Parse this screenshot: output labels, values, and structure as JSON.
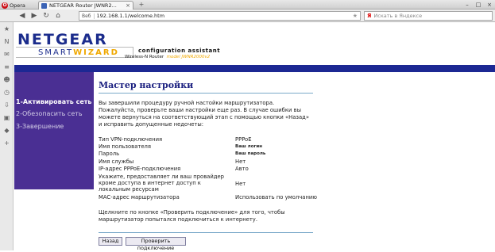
{
  "browser": {
    "app_tab": "Opera",
    "active_tab_title": "NETGEAR Router JWNR2...",
    "new_tab": "+",
    "address_badge": "Веб",
    "url": "192.168.1.1/welcome.htm",
    "search_placeholder": "Искать в Яндексе",
    "search_engine_glyph": "Я"
  },
  "header": {
    "brand": "NETGEAR",
    "smart": "SMART",
    "wizard": "WIZARD",
    "config_title": "configuration assistant",
    "product": "Wireless-N Router",
    "model": "model JWNR2000v2",
    "brand_color": "#1b2c8c",
    "accent_color": "#f0a800",
    "bar_color": "#1c2893"
  },
  "sidebar": {
    "steps": [
      {
        "label": "1-Активировать сеть"
      },
      {
        "label": "2-Обезопасить сеть"
      },
      {
        "label": "3-Завершение"
      }
    ],
    "bg_color": "#4a2f93"
  },
  "content": {
    "title": "Мастер настройки",
    "intro": "Вы завершили процедуру ручной настойки маршрутизатора. Пожалуйста, проверьте ваши настройки еще раз. В случае ошибки вы можете вернуться на соответствующий этап с помощью кнопки «Назад» и исправить допущенные недочеты:",
    "rows": [
      {
        "key": "Тип VPN-подключения",
        "value": "PPPoE"
      },
      {
        "key": "Имя пользователя",
        "value": "Ваш логин"
      },
      {
        "key": "Пароль",
        "value": "Ваш пароль"
      },
      {
        "key": "Имя службы",
        "value": "Нет"
      },
      {
        "key": "IP-адрес PPPoE-подключения",
        "value": "Авто"
      },
      {
        "key": "Укажите, предоставляет ли ваш провайдер кроме доступа в интернет доступ к локальным ресурсам",
        "value": "Нет"
      },
      {
        "key": "MAC-адрес маршрутизатора",
        "value": "Использовать по умолчанию"
      }
    ],
    "outro": "Щелкните по кнопке «Проверить подключение» для того, чтобы маршрутизатор попытался подключиться к интернету.",
    "back_button": "Назад",
    "check_button": "Проверить подключение"
  }
}
